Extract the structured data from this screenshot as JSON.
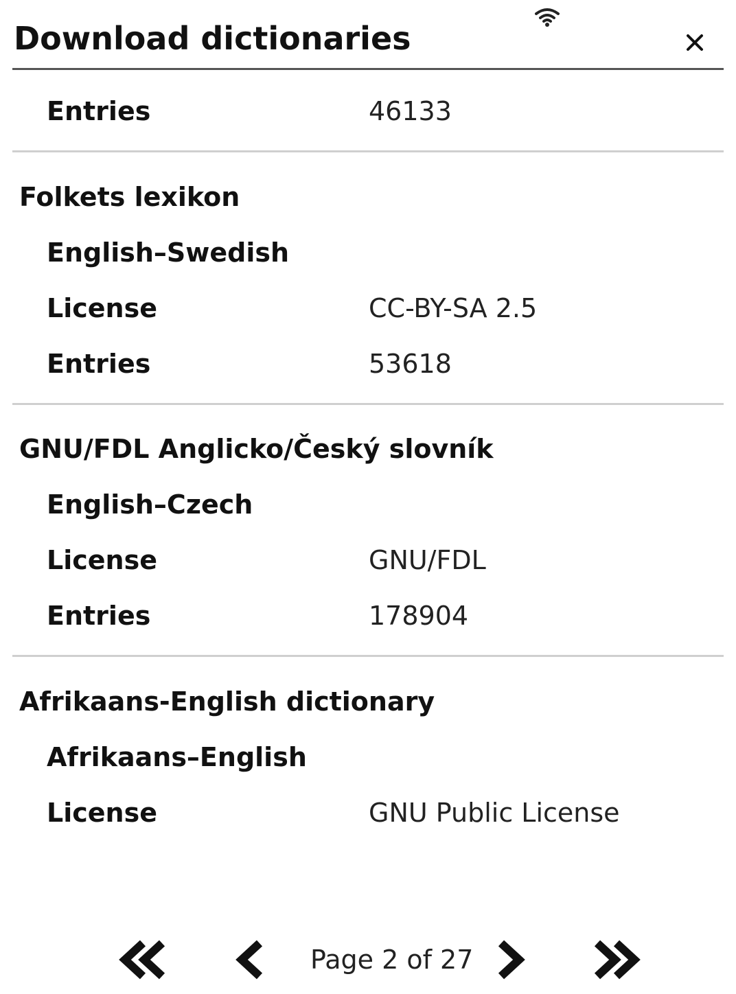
{
  "header": {
    "title": "Download dictionaries",
    "close_icon": "close-icon",
    "status_icon": "wifi-icon"
  },
  "list": {
    "top_partial": {
      "entries_label": "Entries",
      "entries_value": "46133"
    },
    "dictionaries": [
      {
        "name": "Folkets lexikon",
        "languages": "English–Swedish",
        "license_label": "License",
        "license_value": "CC-BY-SA 2.5",
        "entries_label": "Entries",
        "entries_value": "53618"
      },
      {
        "name": "GNU/FDL Anglicko/Český slovník",
        "languages": "English–Czech",
        "license_label": "License",
        "license_value": "GNU/FDL",
        "entries_label": "Entries",
        "entries_value": "178904"
      },
      {
        "name": "Afrikaans-English dictionary",
        "languages": "Afrikaans–English",
        "license_label": "License",
        "license_value": "GNU Public License"
      }
    ]
  },
  "pager": {
    "label": "Page 2 of 27",
    "first_icon": "double-chevron-left-icon",
    "prev_icon": "chevron-left-icon",
    "next_icon": "chevron-right-icon",
    "last_icon": "double-chevron-right-icon"
  }
}
